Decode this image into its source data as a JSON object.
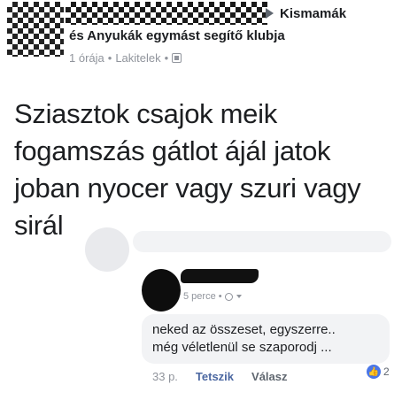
{
  "post": {
    "group_name_line1": "Kismamák",
    "group_name_line2": "és Anyukák egymást segítő klubja",
    "time": "1 órája",
    "location": "Lakitelek",
    "separator": "•",
    "body_lines": [
      "Sziasztok csajok meik",
      "fogamszás gátlot ájál jatok",
      "joban nyocer vagy szuri vagy",
      "sirál"
    ]
  },
  "reply": {
    "time": "5 perce",
    "text_lines": [
      "neked az összeset, egyszerre..",
      "még véletlenül se szaporodj ..."
    ],
    "age": "33 p.",
    "like_label": "Tetszik",
    "reply_label": "Válasz",
    "like_count": "2"
  },
  "colors": {
    "link_blue": "#4b67a1",
    "like_badge": "#4a76e8",
    "meta_gray": "#90949c",
    "bubble_bg": "#f2f3f5"
  }
}
